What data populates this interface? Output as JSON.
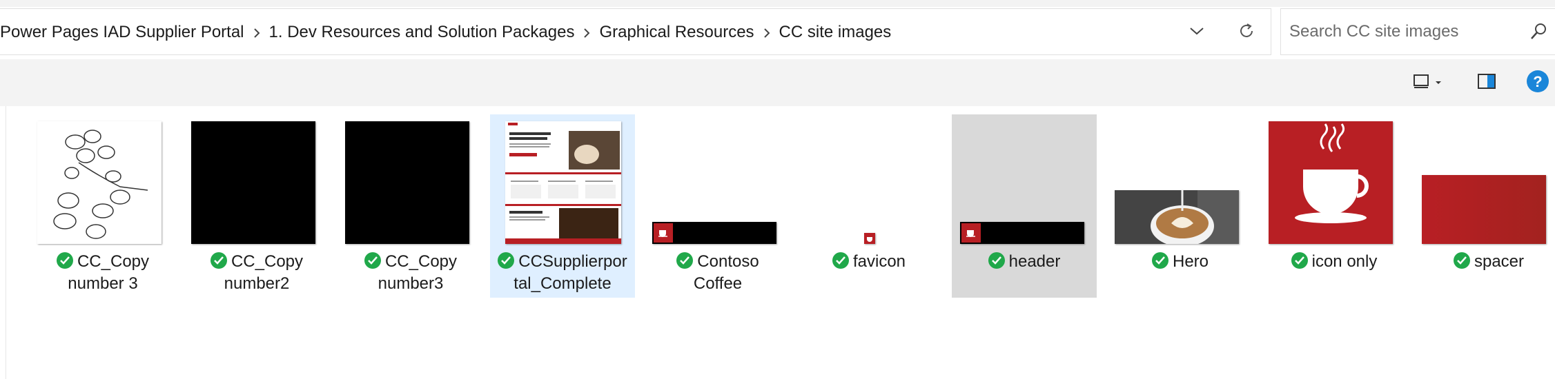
{
  "breadcrumb": {
    "items": [
      "Power Pages IAD Supplier Portal",
      "1. Dev Resources and Solution Packages",
      "Graphical Resources",
      "CC site images"
    ]
  },
  "search": {
    "placeholder": "Search CC site images"
  },
  "icons": {
    "separator": "chevron-right-icon",
    "history": "chevron-down-icon",
    "refresh": "refresh-icon",
    "search": "search-icon",
    "view": "view-icon",
    "view_menu": "caret-down-icon",
    "preview_pane": "preview-pane-icon",
    "help": "help-icon",
    "sync_status": "checkmark-circle-icon"
  },
  "colors": {
    "sync_green": "#20a84a",
    "selection": "#dfefff",
    "brand_red": "#b81f24",
    "help_blue": "#1a86d9"
  },
  "files": [
    {
      "name_line1": "CC_Copy",
      "name_line2": "number 3",
      "thumbnail": "coffee beans sketch"
    },
    {
      "name_line1": "CC_Copy",
      "name_line2": "number2",
      "thumbnail": "black square"
    },
    {
      "name_line1": "CC_Copy",
      "name_line2": "number3",
      "thumbnail": "black square"
    },
    {
      "name_line1": "CCSupplierpor",
      "name_line2": "tal_Complete",
      "thumbnail": "web page mockup",
      "selected": true
    },
    {
      "name_line1": "Contoso",
      "name_line2": "Coffee",
      "thumbnail": "cup logo banner"
    },
    {
      "name_line1": "favicon",
      "name_line2": "",
      "thumbnail": "small red cup"
    },
    {
      "name_line1": "header",
      "name_line2": "",
      "thumbnail": "cup logo banner",
      "hover": true
    },
    {
      "name_line1": "Hero",
      "name_line2": "",
      "thumbnail": "latte art photo"
    },
    {
      "name_line1": "icon only",
      "name_line2": "",
      "thumbnail": "white cup on red"
    },
    {
      "name_line1": "spacer",
      "name_line2": "",
      "thumbnail": "red rectangle"
    }
  ]
}
